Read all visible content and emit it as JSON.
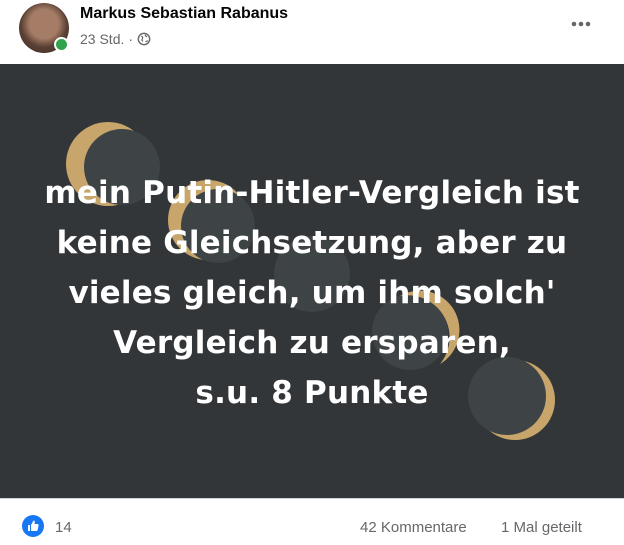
{
  "post": {
    "author": "Markus Sebastian Rabanus",
    "time": "23 Std.",
    "separator": "·",
    "audience_icon": "globe-icon",
    "more_icon": "more-options-icon",
    "text_lines": [
      "mein Putin-Hitler-Vergleich ist",
      "keine Gleichsetzung, aber zu",
      "vieles gleich, um ihm solch'",
      "Vergleich zu ersparen,",
      "s.u. 8 Punkte"
    ],
    "colors": {
      "background": "#333638",
      "moon_gold": "#c7a56b",
      "moon_dark": "#3e4346",
      "text": "#ffffff"
    }
  },
  "reactions": {
    "icon": "thumbs-up-icon",
    "count": "14",
    "comments": "42 Kommentare",
    "shares": "1 Mal geteilt"
  }
}
